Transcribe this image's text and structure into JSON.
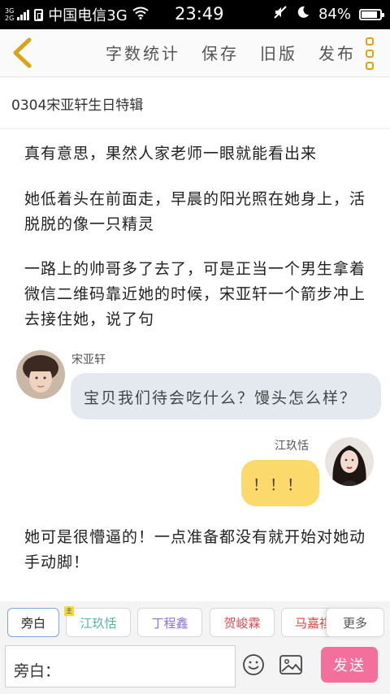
{
  "status_bar": {
    "net_top": "3G",
    "net_bottom": "2G",
    "carrier": "中国电信3G",
    "time": "23:49",
    "battery": "84%"
  },
  "toolbar": {
    "back_icon": "chevron-left-icon",
    "word_count": "字数统计",
    "save": "保存",
    "old_version": "旧版",
    "publish": "发布",
    "more_icon": "more-vertical-icon",
    "accent": "#d9a417"
  },
  "story_title": "0304宋亚轩生日特辑",
  "narration": {
    "p1": "真有意思，果然人家老师一眼就能看出来",
    "p2": "她低着头在前面走，早晨的阳光照在她身上，活脱脱的像一只精灵",
    "p3": "一路上的帅哥多了去了，可是正当一个男生拿着微信二维码靠近她的时候，宋亚轩一个箭步冲上去接住她，说了句",
    "p4": "她可是很懵逼的！一点准备都没有就开始对她动手动脚！"
  },
  "messages": [
    {
      "speaker": "宋亚轩",
      "text": "宝贝我们待会吃什么？馒头怎么样？",
      "side": "left",
      "bubble_color": "#e3e9ef"
    },
    {
      "speaker": "江玖恬",
      "text": "！！！",
      "side": "right",
      "bubble_color": "#fbd96a"
    }
  ],
  "characters": {
    "narrator": "旁白",
    "c1": "江玖恬",
    "c2": "丁程鑫",
    "c3": "贺峻霖",
    "c4": "马嘉祺",
    "more": "更多",
    "badge": "主",
    "colors": {
      "c1": "#4db8a8",
      "c2": "#8b6fd6",
      "c3": "#d94a57",
      "c4": "#e0453c"
    }
  },
  "input": {
    "value": "旁白：",
    "emoji_icon": "emoji-smile-icon",
    "image_icon": "image-icon",
    "send": "发送",
    "send_color": "#f36f9c"
  }
}
